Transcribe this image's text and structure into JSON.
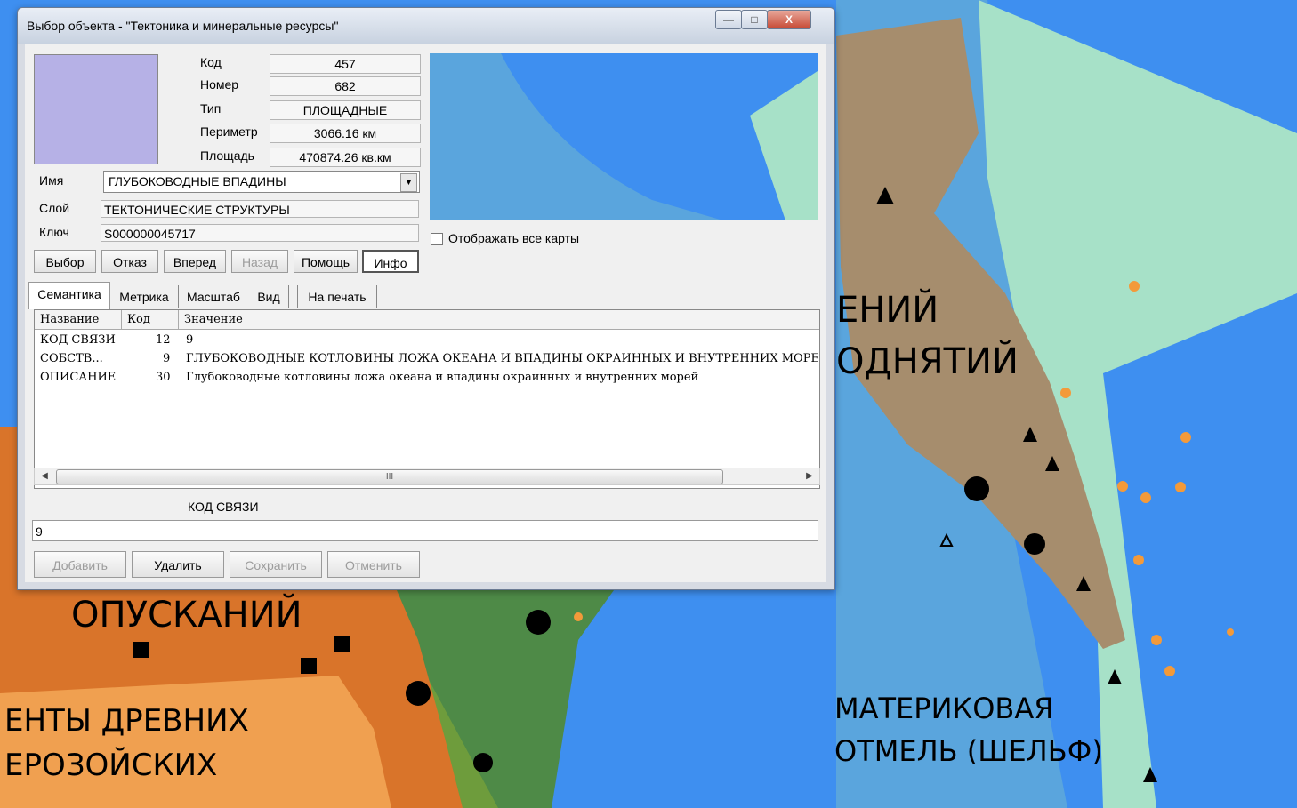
{
  "window": {
    "title": "Выбор объекта - \"Тектоника и минеральные ресурсы\"",
    "controls": {
      "minimize": "—",
      "maximize": "□",
      "close": "X"
    }
  },
  "object": {
    "code_label": "Код",
    "code": "457",
    "number_label": "Номер",
    "number": "682",
    "type_label": "Тип",
    "type": "ПЛОЩАДНЫЕ",
    "perimeter_label": "Периметр",
    "perimeter": "3066.16 км",
    "area_label": "Площадь",
    "area": "470874.26 кв.км",
    "swatch_color": "#b6b1e6"
  },
  "name_label": "Имя",
  "name_value": "ГЛУБОКОВОДНЫЕ ВПАДИНЫ",
  "layer_label": "Слой",
  "layer_value": "ТЕКТОНИЧЕСКИЕ СТРУКТУРЫ",
  "key_label": "Ключ",
  "key_value": "S000000045717",
  "show_all_maps": "Отображать все карты",
  "nav_buttons": {
    "select": "Выбор",
    "cancel": "Отказ",
    "forward": "Вперед",
    "back": "Назад",
    "help": "Помощь",
    "info": "Инфо"
  },
  "tabs": [
    "Семантика",
    "Метрика",
    "Масштаб",
    "Вид",
    "На печать"
  ],
  "table": {
    "headers": [
      "Название",
      "Код",
      "Значение"
    ],
    "rows": [
      {
        "name": "КОД СВЯЗИ",
        "code": "12",
        "value": "9"
      },
      {
        "name": "СОБСТВ...",
        "code": "9",
        "value": "ГЛУБОКОВОДНЫЕ КОТЛОВИНЫ ЛОЖА ОКЕАНА И ВПАДИНЫ ОКРАИННЫХ И ВНУТРЕННИХ МОРЕЙ"
      },
      {
        "name": "ОПИСАНИЕ",
        "code": "30",
        "value": "Глубоководные котловины ложа океана и впадины окраинных и внутренних морей"
      }
    ],
    "scroll_thumb": "III"
  },
  "semantic_caption": "КОД СВЯЗИ",
  "semantic_value": "9",
  "action_buttons": {
    "add": "Добавить",
    "delete": "Удалить",
    "save": "Сохранить",
    "cancel": "Отменить"
  },
  "map_labels": {
    "rising_1": "ЕНИЙ",
    "rising_2": "ОДНЯТИЙ",
    "subsidence": "ОПУСКАНИЙ",
    "ancient_1": "ЕНТЫ ДРЕВНИХ",
    "ancient_2": "ЕРОЗОЙСКИХ",
    "shelf_1": "МАТЕРИКОВАЯ",
    "shelf_2": "ОТМЕЛЬ (ШЕЛЬФ)"
  },
  "colors": {
    "ocean": "#3e8ff0",
    "land": "#a68d6d",
    "shelf_green": "#a7e1c8",
    "terrain_green": "#6e9c3c",
    "subsidence_orange": "#d9742a"
  }
}
